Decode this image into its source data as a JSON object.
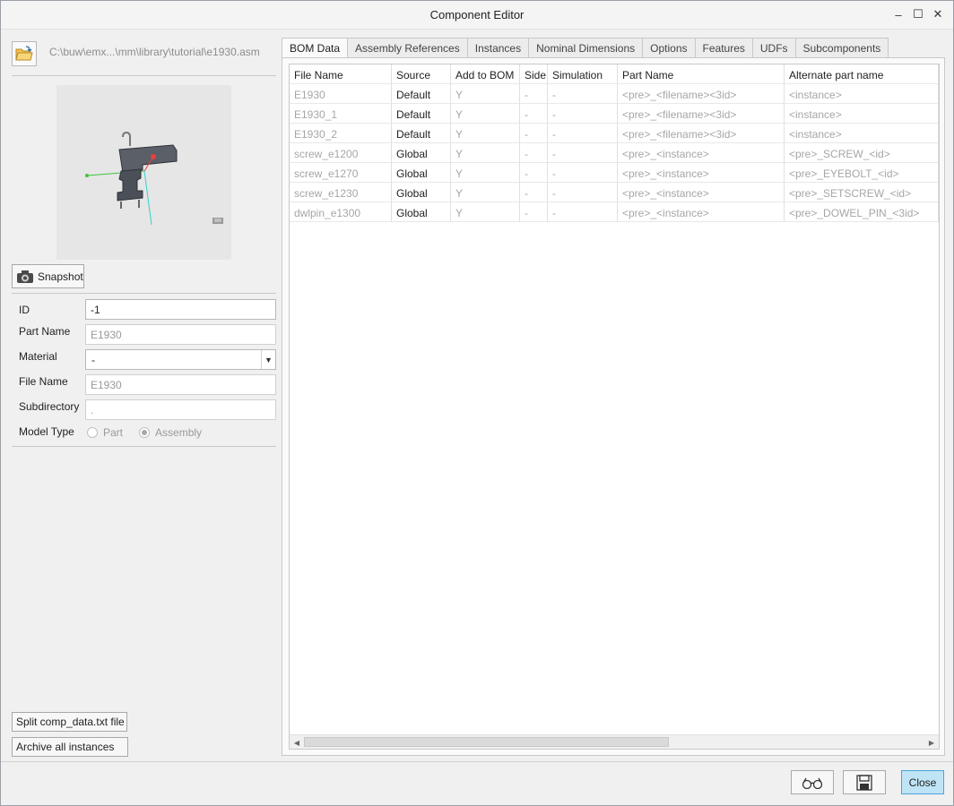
{
  "window": {
    "title": "Component Editor",
    "minimize": "–",
    "maximize": "☐",
    "close": "✕"
  },
  "left": {
    "path": "C:\\buw\\emx...\\mm\\library\\tutorial\\e1930.asm",
    "snapshot_label": "Snapshot",
    "fields": {
      "id_label": "ID",
      "id_value": "-1",
      "part_name_label": "Part Name",
      "part_name_value": "E1930",
      "material_label": "Material",
      "material_value": "-",
      "file_name_label": "File Name",
      "file_name_value": "E1930",
      "subdirectory_label": "Subdirectory",
      "subdirectory_value": ".",
      "model_type_label": "Model Type",
      "model_type_options": [
        "Part",
        "Assembly"
      ],
      "model_type_selected": "Assembly"
    },
    "split_button": "Split comp_data.txt file",
    "archive_button": "Archive all instances"
  },
  "tabs": [
    "BOM Data",
    "Assembly References",
    "Instances",
    "Nominal Dimensions",
    "Options",
    "Features",
    "UDFs",
    "Subcomponents"
  ],
  "active_tab": "BOM Data",
  "table": {
    "columns": [
      "File Name",
      "Source",
      "Add to BOM",
      "Side",
      "Simulation",
      "Part Name",
      "Alternate part name"
    ],
    "rows": [
      [
        "E1930",
        "Default",
        "Y",
        "-",
        "-",
        "<pre>_<filename><3id>",
        "<instance>"
      ],
      [
        "E1930_1",
        "Default",
        "Y",
        "-",
        "-",
        "<pre>_<filename><3id>",
        "<instance>"
      ],
      [
        "E1930_2",
        "Default",
        "Y",
        "-",
        "-",
        "<pre>_<filename><3id>",
        "<instance>"
      ],
      [
        "screw_e1200",
        "Global",
        "Y",
        "-",
        "-",
        "<pre>_<instance>",
        "<pre>_SCREW_<id>"
      ],
      [
        "screw_e1270",
        "Global",
        "Y",
        "-",
        "-",
        "<pre>_<instance>",
        "<pre>_EYEBOLT_<id>"
      ],
      [
        "screw_e1230",
        "Global",
        "Y",
        "-",
        "-",
        "<pre>_<instance>",
        "<pre>_SETSCREW_<id>"
      ],
      [
        "dwlpin_e1300",
        "Global",
        "Y",
        "-",
        "-",
        "<pre>_<instance>",
        "<pre>_DOWEL_PIN_<3id>"
      ]
    ]
  },
  "footer": {
    "close_label": "Close"
  }
}
